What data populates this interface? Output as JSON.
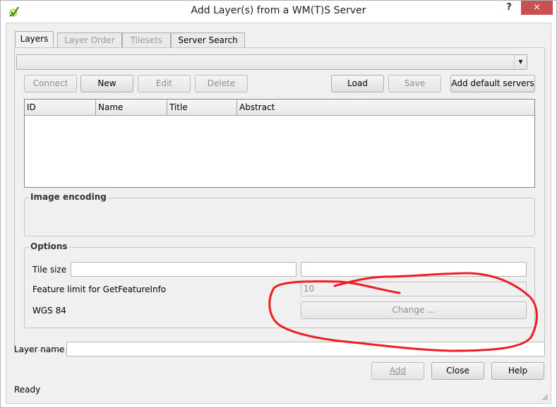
{
  "window": {
    "title": "Add Layer(s) from a WM(T)S Server",
    "help_label": "?",
    "close_label": "×"
  },
  "tabs": [
    {
      "label": "Layers",
      "active": true,
      "enabled": true
    },
    {
      "label": "Layer Order",
      "active": false,
      "enabled": false
    },
    {
      "label": "Tilesets",
      "active": false,
      "enabled": false
    },
    {
      "label": "Server Search",
      "active": false,
      "enabled": true
    }
  ],
  "server_combo": {
    "value": ""
  },
  "connection_buttons": {
    "connect": "Connect",
    "new": "New",
    "edit": "Edit",
    "delete": "Delete",
    "load": "Load",
    "save": "Save",
    "add_default": "Add default servers"
  },
  "layers_table": {
    "columns": [
      "ID",
      "Name",
      "Title",
      "Abstract"
    ],
    "rows": []
  },
  "image_encoding": {
    "title": "Image encoding"
  },
  "options": {
    "title": "Options",
    "tile_size_label": "Tile size",
    "tile_width_value": "",
    "tile_height_value": "",
    "feature_limit_label": "Feature limit for GetFeatureInfo",
    "feature_limit_value": "10",
    "crs_label": "WGS 84",
    "change_label": "Change ..."
  },
  "layer_name": {
    "label": "Layer name",
    "value": ""
  },
  "footer": {
    "add": "Add",
    "close": "Close",
    "help": "Help",
    "status": "Ready"
  },
  "annotation": {
    "color": "#ee1c24"
  }
}
